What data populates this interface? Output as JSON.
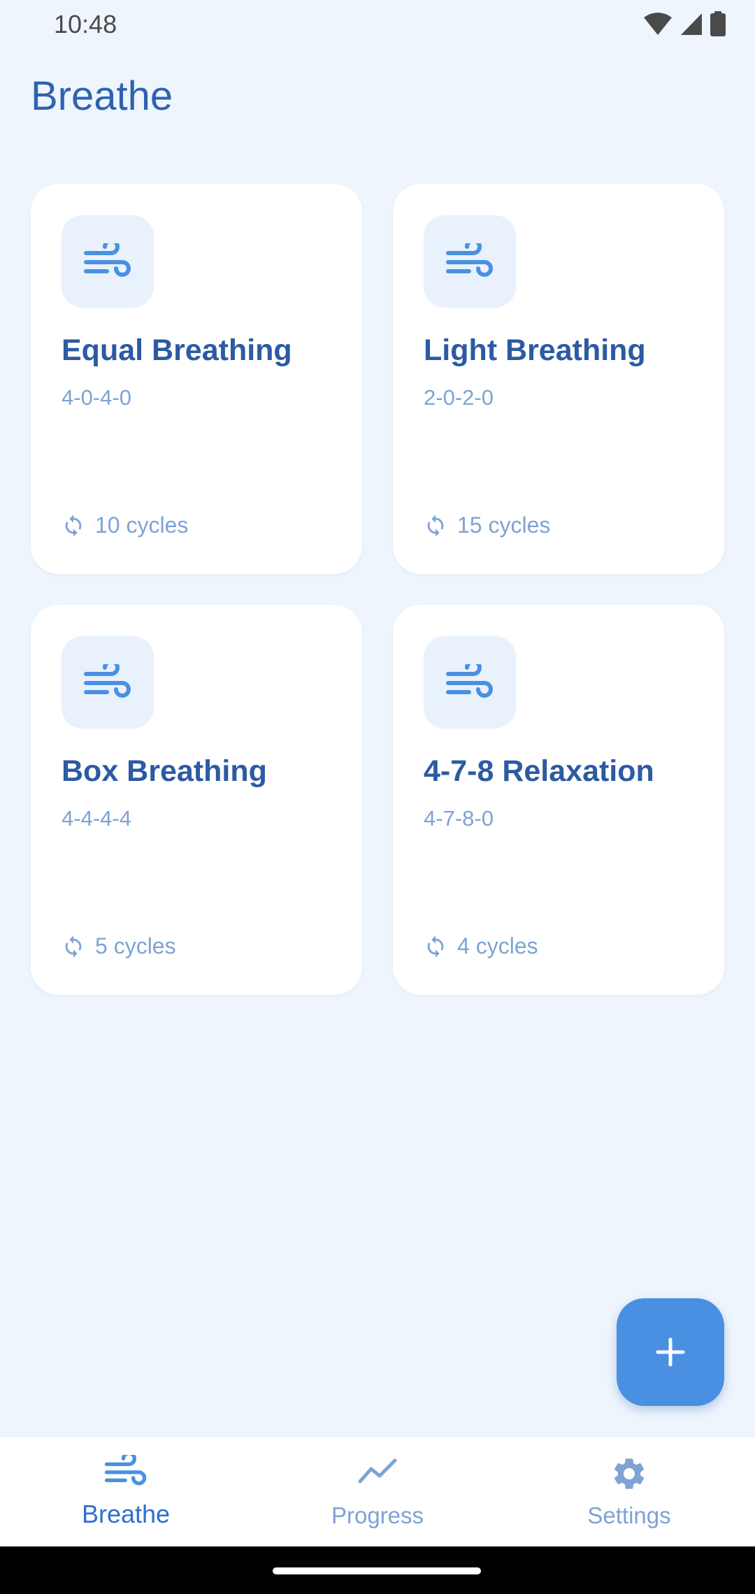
{
  "status_bar": {
    "time": "10:48",
    "icons": [
      "wifi-icon",
      "cellular-signal-icon",
      "battery-icon"
    ]
  },
  "header": {
    "title": "Breathe"
  },
  "exercises": [
    {
      "title": "Equal Breathing",
      "pattern": "4-0-4-0",
      "cycles": "10 cycles",
      "icon": "wind-icon"
    },
    {
      "title": "Light Breathing",
      "pattern": "2-0-2-0",
      "cycles": "15 cycles",
      "icon": "wind-icon"
    },
    {
      "title": "Box Breathing",
      "pattern": "4-4-4-4",
      "cycles": "5 cycles",
      "icon": "wind-icon"
    },
    {
      "title": "4-7-8 Relaxation",
      "pattern": "4-7-8-0",
      "cycles": "4 cycles",
      "icon": "wind-icon"
    }
  ],
  "fab": {
    "icon": "plus-icon"
  },
  "bottom_nav": {
    "items": [
      {
        "label": "Breathe",
        "icon": "wind-icon",
        "active": true
      },
      {
        "label": "Progress",
        "icon": "trending-up-icon",
        "active": false
      },
      {
        "label": "Settings",
        "icon": "gear-icon",
        "active": false
      }
    ]
  },
  "colors": {
    "background": "#eef5fd",
    "card": "#ffffff",
    "accent": "#4a90e2",
    "title": "#2c5aa3",
    "muted": "#7ea3d4"
  }
}
